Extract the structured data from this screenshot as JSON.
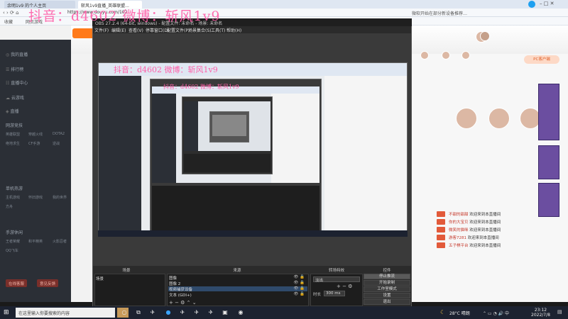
{
  "browser": {
    "tabs": [
      {
        "label": "余明1v9 的个人主页"
      },
      {
        "label": "斩风1v9直播_英雄联盟..."
      }
    ],
    "address": "https://www.douyu.com/102",
    "bookmarks": [
      "收藏",
      "网页游戏"
    ],
    "right_tip": "微软开始在部分新设备推荐…"
  },
  "watermark": {
    "text": "抖音：d4602  微博：斩风1v9"
  },
  "sidebar": {
    "items": [
      {
        "label": "我的直播"
      },
      {
        "label": "排行榜"
      },
      {
        "label": "直播中心"
      },
      {
        "label": "云游戏"
      },
      {
        "label": "直播"
      }
    ],
    "sections": [
      {
        "title": "网游竞技",
        "subs": [
          "英雄联盟",
          "穿越火线",
          "DOTA2",
          "绝地求生",
          "CF手游",
          "逆战"
        ]
      },
      {
        "title": "单机热游",
        "subs": [
          "主机游戏",
          "怀旧游戏",
          "我的世界",
          "方舟"
        ]
      },
      {
        "title": "手游休闲",
        "subs": [
          "王者荣耀",
          "和平精英",
          "火影忍者",
          "QQ飞车"
        ]
      }
    ],
    "buttons": [
      "在线客服",
      "意见反馈"
    ]
  },
  "obs": {
    "title": "OBS 27.2.4 (64-bit, windows) - 配置文件: 未命名 - 场景: 未命名",
    "menu": [
      "文件(F)",
      "编辑(E)",
      "查看(V)",
      "停靠窗口(D)",
      "配置文件(P)",
      "场景集合(S)",
      "工具(T)",
      "帮助(H)"
    ],
    "docks": {
      "scenes": {
        "title": "场景",
        "items": [
          "场景"
        ]
      },
      "sources": {
        "title": "来源",
        "items": [
          "图像",
          "图像 2",
          "视频捕获设备",
          "文本 (GDI+)"
        ]
      },
      "transitions": {
        "title": "转场特效",
        "type": "淡出",
        "duration_label": "时长",
        "duration_value": "300 ms"
      },
      "controls": {
        "title": "控件",
        "buttons": [
          "停止推流",
          "开始录制",
          "工作室模式",
          "设置",
          "退出"
        ]
      }
    }
  },
  "stream_page": {
    "chat": [
      {
        "text": "欢迎来到本直播间",
        "user": "不甜的甜甜"
      },
      {
        "text": "欢迎来到本直播间",
        "user": "你的大宝贝"
      },
      {
        "text": "欢迎来到本直播间",
        "user": "微笑的猫咪"
      },
      {
        "text": "欢迎来到本直播间",
        "user": "游客7281"
      },
      {
        "text": "欢迎来到本直播间",
        "user": "五子棋平台"
      }
    ],
    "badge": "PC客户端"
  },
  "taskbar": {
    "search_placeholder": "在这里输入你要搜索的内容",
    "weather": "28°C 晴朗",
    "time": "23:12",
    "date": "2022/7/8"
  }
}
